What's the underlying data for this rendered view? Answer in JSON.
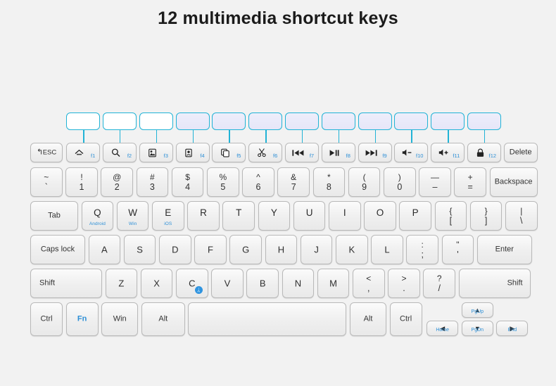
{
  "title": "12 multimedia shortcut keys",
  "colors": {
    "accent_cyan": "#21b3d6",
    "label_blue": "#2d8fd6",
    "bluetooth_blue": "#2f94e0",
    "background": "#f2f2f2",
    "key_face": "#efefef"
  },
  "callouts": [
    {
      "id": "callout-f1",
      "label": "",
      "tint": false
    },
    {
      "id": "callout-f2",
      "label": "",
      "tint": false
    },
    {
      "id": "callout-f3",
      "label": "",
      "tint": false
    },
    {
      "id": "callout-f4",
      "label": "",
      "tint": true
    },
    {
      "id": "callout-f5",
      "label": "",
      "tint": true
    },
    {
      "id": "callout-f6",
      "label": "",
      "tint": true
    },
    {
      "id": "callout-f7",
      "label": "",
      "tint": true
    },
    {
      "id": "callout-f8",
      "label": "",
      "tint": true
    },
    {
      "id": "callout-f9",
      "label": "",
      "tint": true
    },
    {
      "id": "callout-f10",
      "label": "",
      "tint": true
    },
    {
      "id": "callout-f11",
      "label": "",
      "tint": true
    },
    {
      "id": "callout-f12",
      "label": "",
      "tint": true
    }
  ],
  "function_row": {
    "esc": {
      "label": "ESC",
      "icon": "return-arrow-icon"
    },
    "keys": [
      {
        "fn": "f1",
        "icon": "home-icon"
      },
      {
        "fn": "f2",
        "icon": "search-icon"
      },
      {
        "fn": "f3",
        "icon": "image-icon"
      },
      {
        "fn": "f4",
        "icon": "device-icon"
      },
      {
        "fn": "f5",
        "icon": "copy-icon"
      },
      {
        "fn": "f6",
        "icon": "scissors-icon"
      },
      {
        "fn": "f7",
        "icon": "previous-track-icon"
      },
      {
        "fn": "f8",
        "icon": "play-pause-icon"
      },
      {
        "fn": "f9",
        "icon": "next-track-icon"
      },
      {
        "fn": "f10",
        "icon": "volume-down-icon"
      },
      {
        "fn": "f11",
        "icon": "volume-up-icon"
      },
      {
        "fn": "f12",
        "icon": "lock-icon"
      }
    ],
    "delete": "Delete"
  },
  "number_row": {
    "keys": [
      {
        "upper": "~",
        "lower": "`"
      },
      {
        "upper": "!",
        "lower": "1"
      },
      {
        "upper": "@",
        "lower": "2"
      },
      {
        "upper": "#",
        "lower": "3"
      },
      {
        "upper": "$",
        "lower": "4"
      },
      {
        "upper": "%",
        "lower": "5"
      },
      {
        "upper": "^",
        "lower": "6"
      },
      {
        "upper": "&",
        "lower": "7"
      },
      {
        "upper": "*",
        "lower": "8"
      },
      {
        "upper": "(",
        "lower": "9"
      },
      {
        "upper": ")",
        "lower": "0"
      },
      {
        "upper": "—",
        "lower": "–"
      },
      {
        "upper": "+",
        "lower": "="
      }
    ],
    "backspace": "Backspace"
  },
  "qwerty_row": {
    "tab": "Tab",
    "keys": [
      {
        "letter": "Q",
        "sub": "Android"
      },
      {
        "letter": "W",
        "sub": "Win"
      },
      {
        "letter": "E",
        "sub": "iOS"
      },
      {
        "letter": "R",
        "sub": ""
      },
      {
        "letter": "T",
        "sub": ""
      },
      {
        "letter": "Y",
        "sub": ""
      },
      {
        "letter": "U",
        "sub": ""
      },
      {
        "letter": "I",
        "sub": ""
      },
      {
        "letter": "O",
        "sub": ""
      },
      {
        "letter": "P",
        "sub": ""
      }
    ],
    "brackets": [
      {
        "upper": "{",
        "lower": "["
      },
      {
        "upper": "}",
        "lower": "]"
      },
      {
        "upper": "|",
        "lower": "\\"
      }
    ]
  },
  "home_row": {
    "caps_lock": "Caps lock",
    "keys": [
      "A",
      "S",
      "D",
      "F",
      "G",
      "H",
      "J",
      "K",
      "L"
    ],
    "punct": [
      {
        "upper": ":",
        "lower": ";"
      },
      {
        "upper": "\"",
        "lower": "'"
      }
    ],
    "enter": "Enter"
  },
  "shift_row": {
    "shift_left": "Shift",
    "keys": [
      {
        "letter": "Z",
        "bluetooth": false
      },
      {
        "letter": "X",
        "bluetooth": false
      },
      {
        "letter": "C",
        "bluetooth": true
      },
      {
        "letter": "V",
        "bluetooth": false
      },
      {
        "letter": "B",
        "bluetooth": false
      },
      {
        "letter": "N",
        "bluetooth": false
      },
      {
        "letter": "M",
        "bluetooth": false
      }
    ],
    "punct": [
      {
        "upper": "<",
        "lower": ","
      },
      {
        "upper": ">",
        "lower": "."
      },
      {
        "upper": "?",
        "lower": "/"
      }
    ],
    "shift_right": "Shift"
  },
  "bottom_row": {
    "ctrl_left": "Ctrl",
    "fn": "Fn",
    "win": "Win",
    "alt_left": "Alt",
    "space": "",
    "alt_right": "Alt",
    "ctrl_right": "Ctrl",
    "arrows": {
      "up": {
        "glyph": "▲",
        "sub": "PgUp"
      },
      "down": {
        "glyph": "▼",
        "sub": "PgDn"
      },
      "left": {
        "glyph": "◀",
        "sub": "Home"
      },
      "right": {
        "glyph": "▶",
        "sub": "End"
      }
    }
  }
}
